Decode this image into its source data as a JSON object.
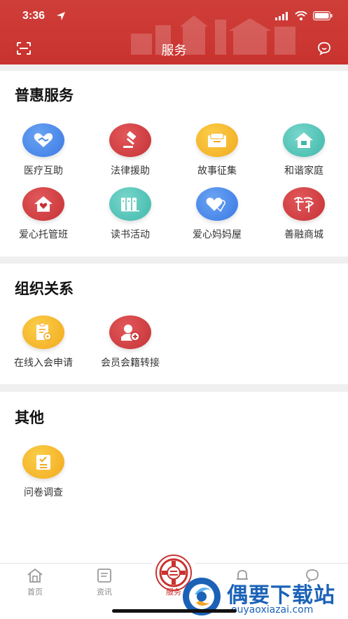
{
  "status_bar": {
    "time": "3:36"
  },
  "nav": {
    "title": "服务"
  },
  "sections": [
    {
      "title": "普惠服务",
      "items": [
        {
          "label": "医疗互助",
          "icon": "handshake-heart-icon",
          "color": "#4a86ea"
        },
        {
          "label": "法律援助",
          "icon": "gavel-icon",
          "color": "#d23c3e"
        },
        {
          "label": "故事征集",
          "icon": "envelope-icon",
          "color": "#f5b52b"
        },
        {
          "label": "和谐家庭",
          "icon": "house-icon",
          "color": "#4fc3b6"
        },
        {
          "label": "爱心托管班",
          "icon": "heart-house-icon",
          "color": "#d23c3e"
        },
        {
          "label": "读书活动",
          "icon": "books-icon",
          "color": "#4fc3b6"
        },
        {
          "label": "爱心妈妈屋",
          "icon": "double-heart-icon",
          "color": "#4a86ea"
        },
        {
          "label": "善融商城",
          "icon": "shanrong-logo-icon",
          "color": "#d23c3e"
        }
      ]
    },
    {
      "title": "组织关系",
      "items": [
        {
          "label": "在线入会申请",
          "icon": "application-form-icon",
          "color": "#f5b52b"
        },
        {
          "label": "会员会籍转接",
          "icon": "add-user-icon",
          "color": "#d23c3e"
        }
      ]
    },
    {
      "title": "其他",
      "items": [
        {
          "label": "问卷调查",
          "icon": "survey-icon",
          "color": "#f5b52b"
        }
      ]
    }
  ],
  "tabbar": {
    "tabs": [
      {
        "label": "首页",
        "icon": "home-icon"
      },
      {
        "label": "资讯",
        "icon": "news-icon"
      },
      {
        "label": "服务",
        "icon": "union-logo-icon",
        "active": true
      },
      {
        "label": "",
        "icon": "bell-icon"
      },
      {
        "label": "",
        "icon": "chat-icon"
      }
    ]
  },
  "watermark": {
    "title": "偶要下载站",
    "url": "ouyaoxiazai.com"
  },
  "colors": {
    "primary": "#c9332f",
    "accent_blue": "#1b62b7"
  }
}
